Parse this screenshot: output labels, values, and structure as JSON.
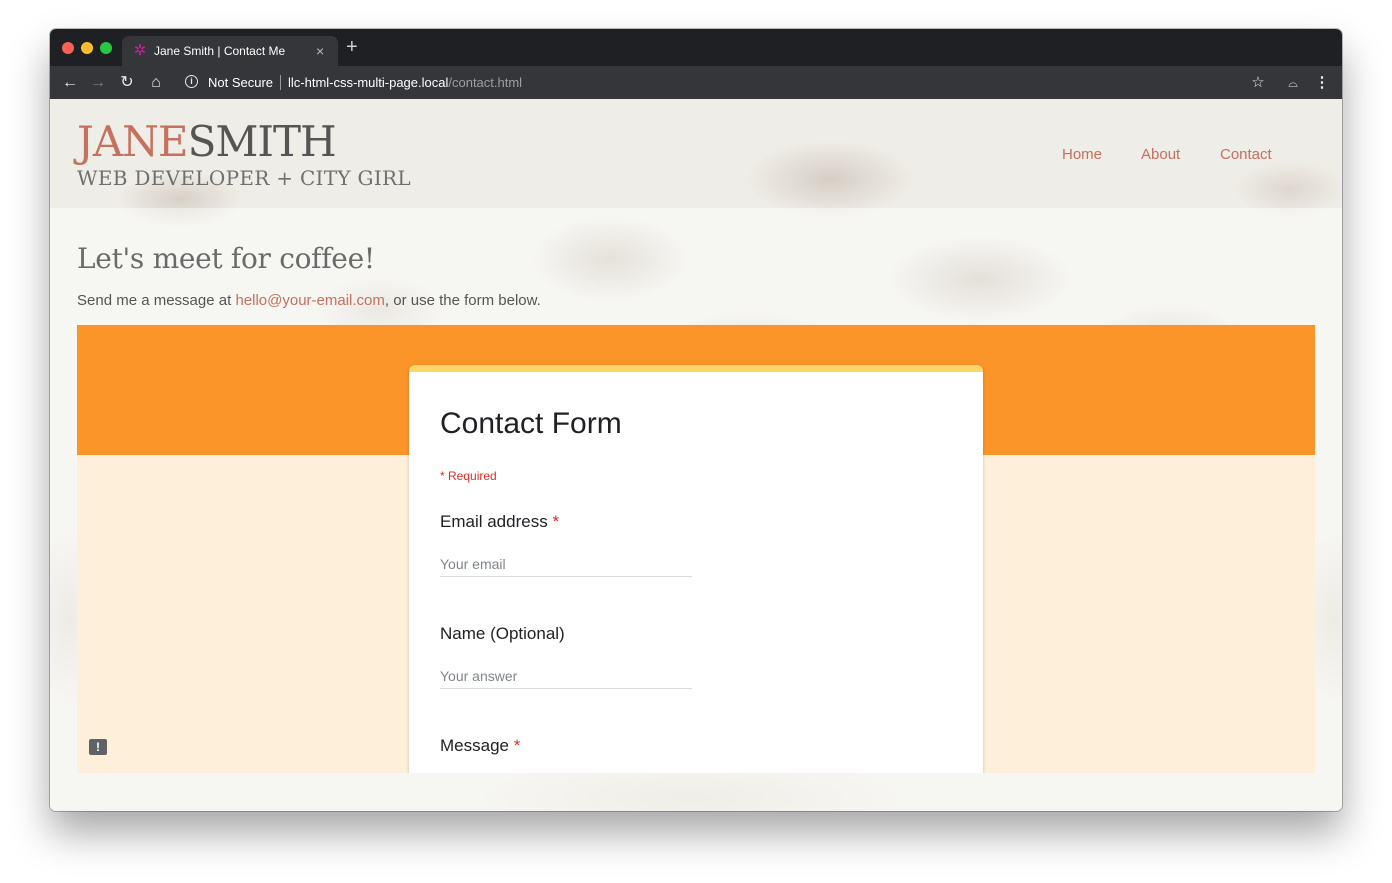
{
  "browser": {
    "tab_title": "Jane Smith | Contact Me",
    "tab_close": "×",
    "new_tab": "+",
    "security_label": "Not Secure",
    "url_host": "llc-html-css-multi-page.local",
    "url_path": "/contact.html",
    "icons": {
      "back": "back-arrow-icon",
      "forward": "forward-arrow-icon",
      "reload": "reload-icon",
      "home": "home-icon",
      "info": "info-icon",
      "star": "star-icon",
      "incognito": "incognito-icon",
      "menu": "menu-icon"
    }
  },
  "site": {
    "logo_first": "JANE",
    "logo_last": "SMITH",
    "tagline": "WEB DEVELOPER + CITY GIRL",
    "nav": [
      "Home",
      "About",
      "Contact"
    ],
    "colors": {
      "accent": "#c4715e",
      "text": "#555555"
    }
  },
  "main": {
    "heading": "Let's meet for coffee!",
    "intro_prefix": "Send me a message at ",
    "intro_email": "hello@your-email.com",
    "intro_suffix": ", or use the form below."
  },
  "form": {
    "title": "Contact Form",
    "required_note": "* Required",
    "questions": [
      {
        "label": "Email address",
        "required": "*",
        "placeholder": "Your email"
      },
      {
        "label": "Name (Optional)",
        "placeholder": "Your answer"
      },
      {
        "label": "Message",
        "required": "*"
      }
    ],
    "colors": {
      "header": "#fb9529",
      "background": "#fdefd9",
      "card_accent": "#fdd568",
      "required": "#d93025"
    }
  }
}
